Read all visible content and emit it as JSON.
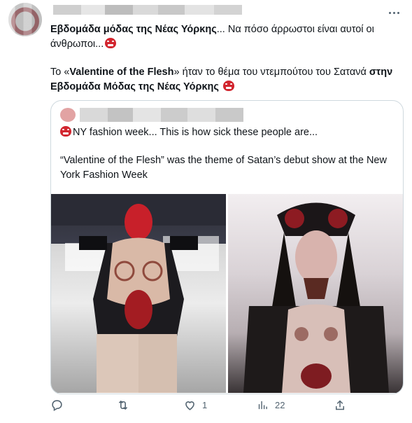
{
  "tweet": {
    "line1_bold": "Εβδομάδα μόδας της Νέας Υόρκης",
    "line1_rest": "... Να πόσο άρρωστοι είναι αυτοί οι άνθρωποι...",
    "line2_pre": "Το «",
    "line2_bold": "Valentine of the Flesh",
    "line2_mid": "» ήταν το θέμα του ντεμπούτου του Σατανά ",
    "line2_bold2": "στην Εβδομάδα Μόδας της Νέας Υόρκης",
    "emoji_icon": "angry-face-emoji"
  },
  "quote": {
    "line1": "NY fashion week... This is how sick these people are...",
    "line2": "“Valentine of the Flesh” was the theme of Satan’s debut show at the New York Fashion Week"
  },
  "actions": {
    "reply_count": "",
    "retweet_count": "",
    "like_count": "1",
    "views_count": "22"
  },
  "colors": {
    "icon": "#536471",
    "border": "#cfd9de",
    "text": "#0f1419",
    "emoji": "#d2262f"
  }
}
